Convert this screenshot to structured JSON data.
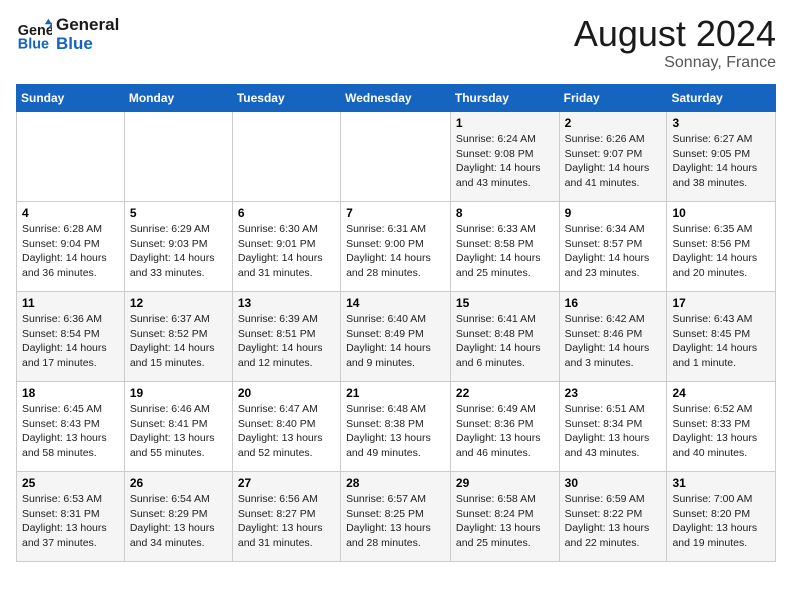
{
  "logo": {
    "line1": "General",
    "line2": "Blue"
  },
  "title": {
    "month_year": "August 2024",
    "location": "Sonnay, France"
  },
  "days_of_week": [
    "Sunday",
    "Monday",
    "Tuesday",
    "Wednesday",
    "Thursday",
    "Friday",
    "Saturday"
  ],
  "weeks": [
    [
      {
        "day": "",
        "info": ""
      },
      {
        "day": "",
        "info": ""
      },
      {
        "day": "",
        "info": ""
      },
      {
        "day": "",
        "info": ""
      },
      {
        "day": "1",
        "info": "Sunrise: 6:24 AM\nSunset: 9:08 PM\nDaylight: 14 hours\nand 43 minutes."
      },
      {
        "day": "2",
        "info": "Sunrise: 6:26 AM\nSunset: 9:07 PM\nDaylight: 14 hours\nand 41 minutes."
      },
      {
        "day": "3",
        "info": "Sunrise: 6:27 AM\nSunset: 9:05 PM\nDaylight: 14 hours\nand 38 minutes."
      }
    ],
    [
      {
        "day": "4",
        "info": "Sunrise: 6:28 AM\nSunset: 9:04 PM\nDaylight: 14 hours\nand 36 minutes."
      },
      {
        "day": "5",
        "info": "Sunrise: 6:29 AM\nSunset: 9:03 PM\nDaylight: 14 hours\nand 33 minutes."
      },
      {
        "day": "6",
        "info": "Sunrise: 6:30 AM\nSunset: 9:01 PM\nDaylight: 14 hours\nand 31 minutes."
      },
      {
        "day": "7",
        "info": "Sunrise: 6:31 AM\nSunset: 9:00 PM\nDaylight: 14 hours\nand 28 minutes."
      },
      {
        "day": "8",
        "info": "Sunrise: 6:33 AM\nSunset: 8:58 PM\nDaylight: 14 hours\nand 25 minutes."
      },
      {
        "day": "9",
        "info": "Sunrise: 6:34 AM\nSunset: 8:57 PM\nDaylight: 14 hours\nand 23 minutes."
      },
      {
        "day": "10",
        "info": "Sunrise: 6:35 AM\nSunset: 8:56 PM\nDaylight: 14 hours\nand 20 minutes."
      }
    ],
    [
      {
        "day": "11",
        "info": "Sunrise: 6:36 AM\nSunset: 8:54 PM\nDaylight: 14 hours\nand 17 minutes."
      },
      {
        "day": "12",
        "info": "Sunrise: 6:37 AM\nSunset: 8:52 PM\nDaylight: 14 hours\nand 15 minutes."
      },
      {
        "day": "13",
        "info": "Sunrise: 6:39 AM\nSunset: 8:51 PM\nDaylight: 14 hours\nand 12 minutes."
      },
      {
        "day": "14",
        "info": "Sunrise: 6:40 AM\nSunset: 8:49 PM\nDaylight: 14 hours\nand 9 minutes."
      },
      {
        "day": "15",
        "info": "Sunrise: 6:41 AM\nSunset: 8:48 PM\nDaylight: 14 hours\nand 6 minutes."
      },
      {
        "day": "16",
        "info": "Sunrise: 6:42 AM\nSunset: 8:46 PM\nDaylight: 14 hours\nand 3 minutes."
      },
      {
        "day": "17",
        "info": "Sunrise: 6:43 AM\nSunset: 8:45 PM\nDaylight: 14 hours\nand 1 minute."
      }
    ],
    [
      {
        "day": "18",
        "info": "Sunrise: 6:45 AM\nSunset: 8:43 PM\nDaylight: 13 hours\nand 58 minutes."
      },
      {
        "day": "19",
        "info": "Sunrise: 6:46 AM\nSunset: 8:41 PM\nDaylight: 13 hours\nand 55 minutes."
      },
      {
        "day": "20",
        "info": "Sunrise: 6:47 AM\nSunset: 8:40 PM\nDaylight: 13 hours\nand 52 minutes."
      },
      {
        "day": "21",
        "info": "Sunrise: 6:48 AM\nSunset: 8:38 PM\nDaylight: 13 hours\nand 49 minutes."
      },
      {
        "day": "22",
        "info": "Sunrise: 6:49 AM\nSunset: 8:36 PM\nDaylight: 13 hours\nand 46 minutes."
      },
      {
        "day": "23",
        "info": "Sunrise: 6:51 AM\nSunset: 8:34 PM\nDaylight: 13 hours\nand 43 minutes."
      },
      {
        "day": "24",
        "info": "Sunrise: 6:52 AM\nSunset: 8:33 PM\nDaylight: 13 hours\nand 40 minutes."
      }
    ],
    [
      {
        "day": "25",
        "info": "Sunrise: 6:53 AM\nSunset: 8:31 PM\nDaylight: 13 hours\nand 37 minutes."
      },
      {
        "day": "26",
        "info": "Sunrise: 6:54 AM\nSunset: 8:29 PM\nDaylight: 13 hours\nand 34 minutes."
      },
      {
        "day": "27",
        "info": "Sunrise: 6:56 AM\nSunset: 8:27 PM\nDaylight: 13 hours\nand 31 minutes."
      },
      {
        "day": "28",
        "info": "Sunrise: 6:57 AM\nSunset: 8:25 PM\nDaylight: 13 hours\nand 28 minutes."
      },
      {
        "day": "29",
        "info": "Sunrise: 6:58 AM\nSunset: 8:24 PM\nDaylight: 13 hours\nand 25 minutes."
      },
      {
        "day": "30",
        "info": "Sunrise: 6:59 AM\nSunset: 8:22 PM\nDaylight: 13 hours\nand 22 minutes."
      },
      {
        "day": "31",
        "info": "Sunrise: 7:00 AM\nSunset: 8:20 PM\nDaylight: 13 hours\nand 19 minutes."
      }
    ]
  ]
}
